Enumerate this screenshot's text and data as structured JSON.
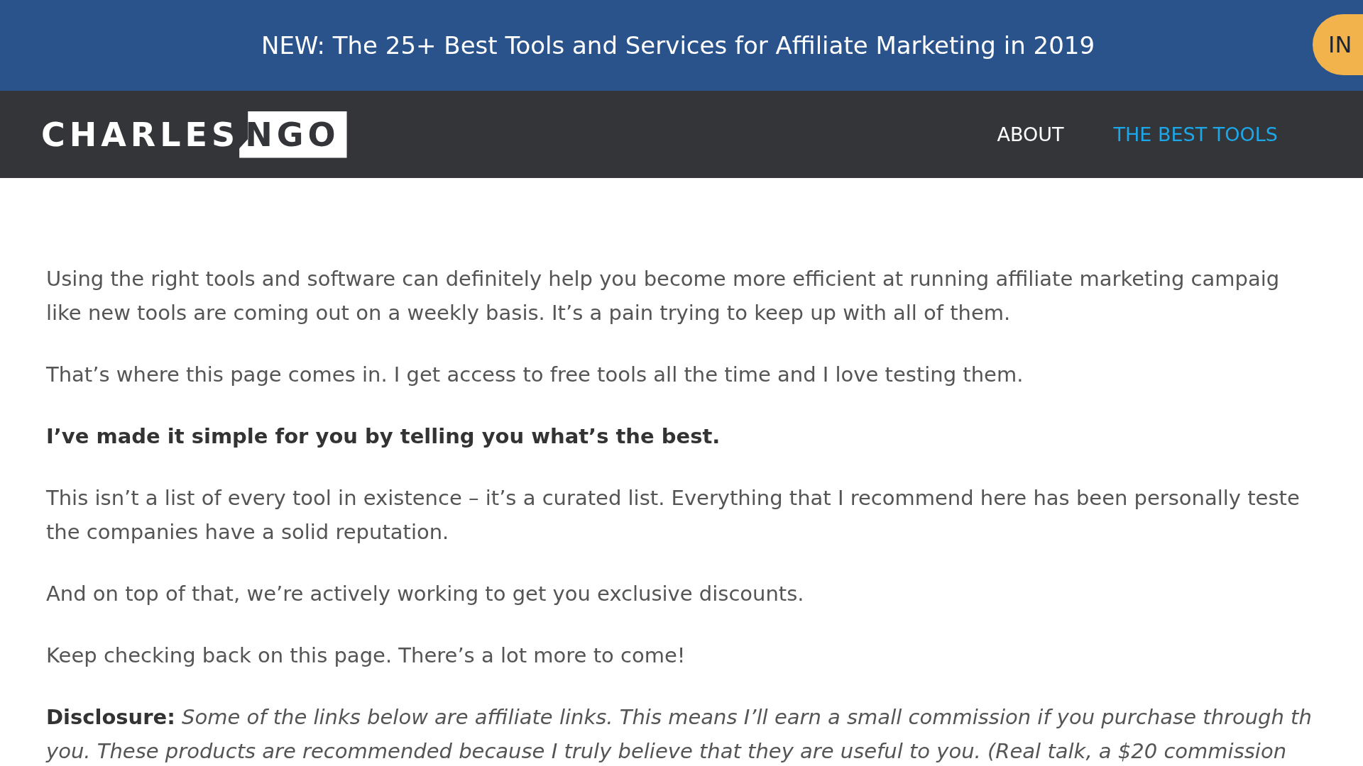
{
  "announcement": {
    "text": "NEW: The 25+ Best Tools and Services for Affiliate Marketing in 2019",
    "button": "IN"
  },
  "header": {
    "logo": {
      "first": "CHARLES",
      "second": "NGO"
    },
    "nav": [
      {
        "label": "ABOUT",
        "selected": false
      },
      {
        "label": "THE BEST TOOLS",
        "selected": true
      }
    ]
  },
  "content": {
    "paragraphs": [
      {
        "kind": "plain",
        "lines": [
          "Using the right tools and software can definitely help you become more efficient at running affiliate marketing campaig",
          "like new tools are coming out on a weekly basis. It’s a pain trying to keep up with all of them."
        ]
      },
      {
        "kind": "plain",
        "lines": [
          "That’s where this page comes in. I get access to free tools all the time and I love testing them."
        ]
      },
      {
        "kind": "bold",
        "lines": [
          "I’ve made it simple for you by telling you what’s the best."
        ]
      },
      {
        "kind": "plain",
        "lines": [
          "This isn’t a list of every tool in existence – it’s a curated list. Everything that I recommend here has been personally teste",
          "the companies have a solid reputation."
        ]
      },
      {
        "kind": "plain",
        "lines": [
          "And on top of that, we’re actively working to get you exclusive discounts."
        ]
      },
      {
        "kind": "plain",
        "lines": [
          "Keep checking back on this page. There’s a lot more to come!"
        ]
      },
      {
        "kind": "disclosure",
        "lines": [
          "**Disclosure:** *Some of the links below are affiliate links. This means I’ll earn a small commission if you purchase through th*",
          "*you. These products are recommended because I truly believe that they are useful to you. (Real talk, a $20 commission*"
        ]
      }
    ]
  }
}
